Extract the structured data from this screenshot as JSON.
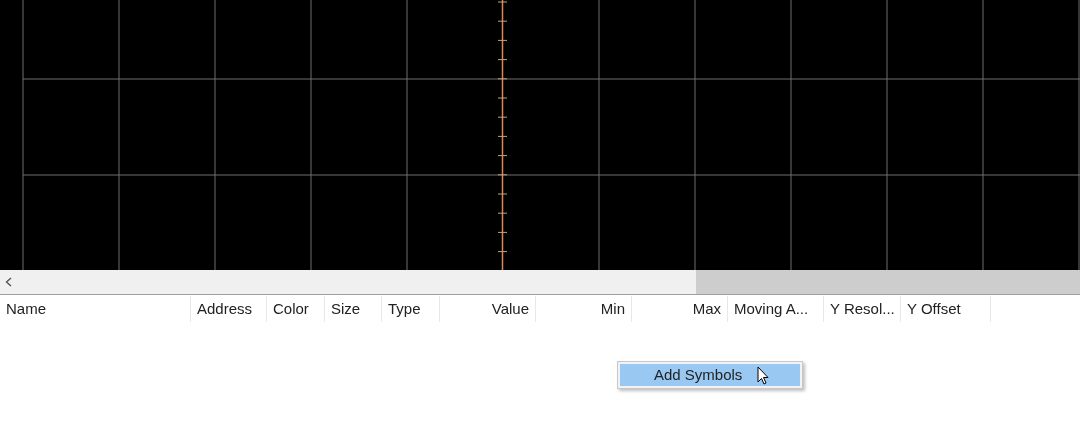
{
  "table": {
    "columns": [
      {
        "label": "Name"
      },
      {
        "label": "Address"
      },
      {
        "label": "Color"
      },
      {
        "label": "Size"
      },
      {
        "label": "Type"
      },
      {
        "label": "Value"
      },
      {
        "label": "Min"
      },
      {
        "label": "Max"
      },
      {
        "label": "Moving A..."
      },
      {
        "label": "Y Resol..."
      },
      {
        "label": "Y Offset"
      }
    ]
  },
  "context_menu": {
    "items": [
      {
        "label": "Add Symbols",
        "selected": true
      }
    ]
  }
}
